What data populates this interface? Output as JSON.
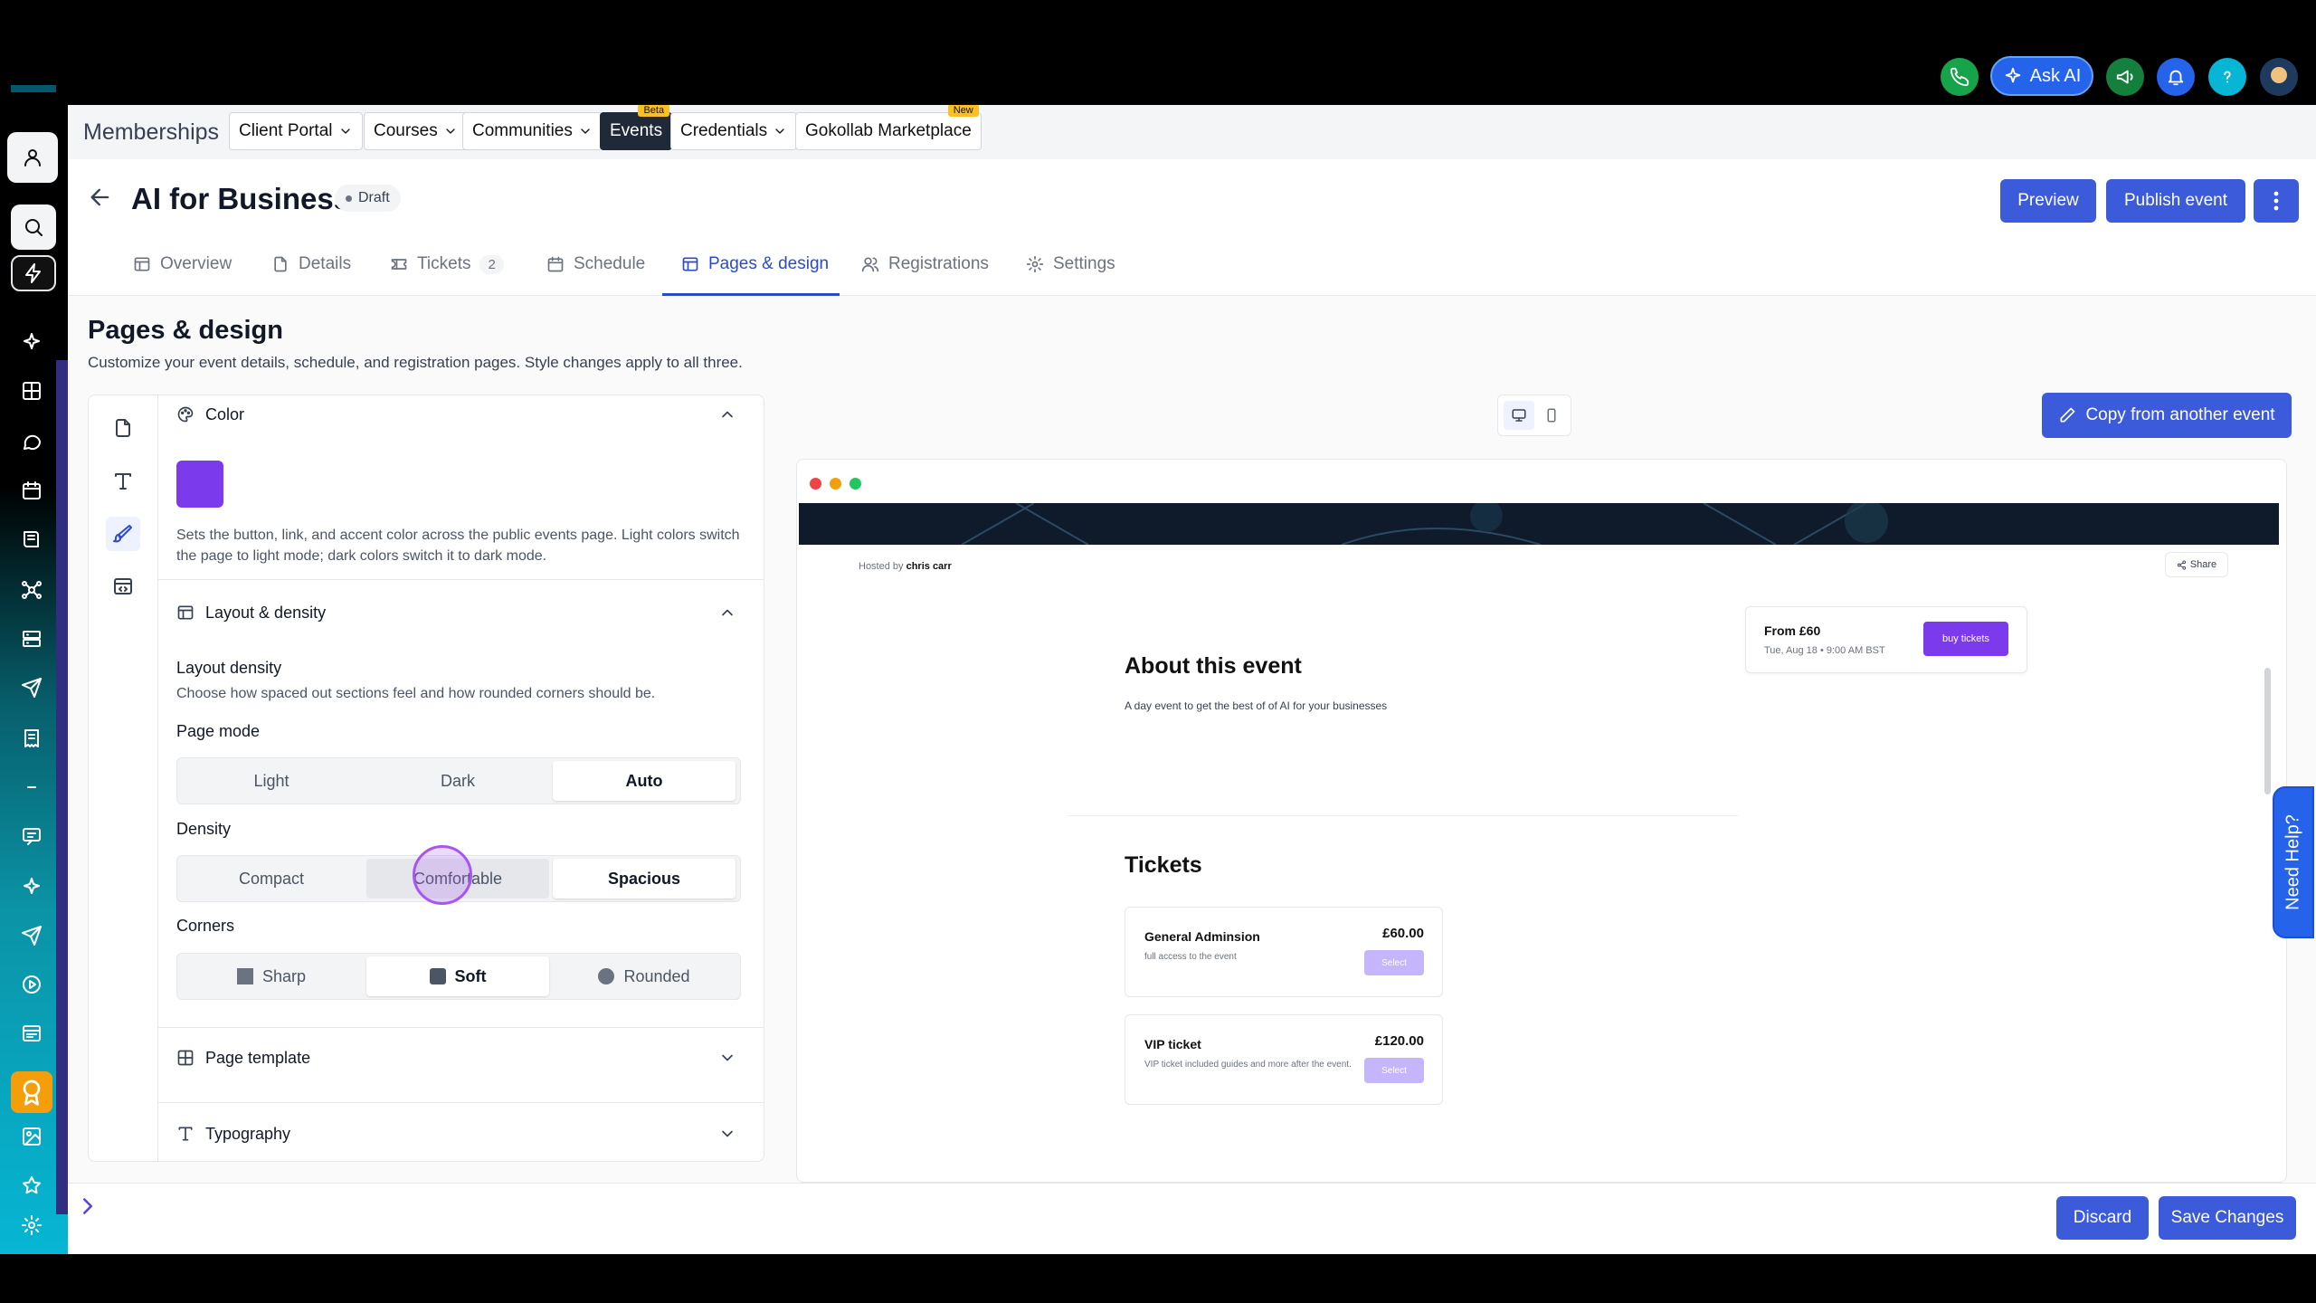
{
  "topbar": {
    "ask_ai_label": "Ask AI",
    "icons": [
      "phone-icon",
      "megaphone-icon",
      "bell-icon",
      "help-icon",
      "avatar"
    ],
    "colors": {
      "phone": "#16a34a",
      "ask_ai": "#2563eb",
      "megaphone": "#15803d",
      "bell": "#2563eb",
      "help": "#06b6d4"
    }
  },
  "subnav": {
    "label": "Memberships",
    "items": [
      {
        "label": "Client Portal",
        "dropdown": true
      },
      {
        "label": "Courses",
        "dropdown": true
      },
      {
        "label": "Communities",
        "dropdown": true
      },
      {
        "label": "Events",
        "badge": "Beta",
        "active": true
      },
      {
        "label": "Credentials",
        "dropdown": true
      },
      {
        "label": "Gokollab Marketplace",
        "badge": "New"
      }
    ]
  },
  "header": {
    "title": "AI for Business",
    "status": "Draft",
    "preview_label": "Preview",
    "publish_label": "Publish event"
  },
  "tabs": [
    {
      "label": "Overview",
      "icon": "layout-icon"
    },
    {
      "label": "Details",
      "icon": "file-icon"
    },
    {
      "label": "Tickets",
      "icon": "ticket-icon",
      "count": "2"
    },
    {
      "label": "Schedule",
      "icon": "calendar-icon"
    },
    {
      "label": "Pages & design",
      "icon": "layout-icon",
      "active": true
    },
    {
      "label": "Registrations",
      "icon": "users-icon"
    },
    {
      "label": "Settings",
      "icon": "gear-icon"
    }
  ],
  "page": {
    "title": "Pages & design",
    "subtitle": "Customize your event details, schedule, and registration pages. Style changes apply to all three."
  },
  "panel": {
    "color": {
      "heading": "Color",
      "value": "#7c3aed",
      "description_1": "Sets the button, link, and accent color across the public events page. Light colors switch",
      "description_2": "the page to light mode; dark colors switch it to dark mode."
    },
    "layout": {
      "heading": "Layout & density",
      "density_title": "Layout density",
      "density_desc": "Choose how spaced out sections feel and how rounded corners should be.",
      "page_mode_label": "Page mode",
      "page_mode_options": [
        "Light",
        "Dark",
        "Auto"
      ],
      "page_mode_selected": "Auto",
      "density_label": "Density",
      "density_options": [
        "Compact",
        "Comfortable",
        "Spacious"
      ],
      "density_selected": "Spacious",
      "corners_label": "Corners",
      "corners_options": [
        "Sharp",
        "Soft",
        "Rounded"
      ],
      "corners_selected": "Soft"
    },
    "template_heading": "Page template",
    "typography_heading": "Typography"
  },
  "copy_button": "Copy from another event",
  "preview": {
    "hosted_prefix": "Hosted by",
    "host": "chris carr",
    "share": "Share",
    "from_price": "From £60",
    "date": "Tue, Aug 18 • 9:00 AM BST",
    "buy_label": "buy tickets",
    "about_title": "About this event",
    "about_desc": "A day event to get the best of of AI for your businesses",
    "tickets_title": "Tickets",
    "tickets": [
      {
        "name": "General Adminsion",
        "desc": "full access to the event",
        "price": "£60.00",
        "button": "Select"
      },
      {
        "name": "VIP ticket",
        "desc": "VIP ticket included guides and more after the event.",
        "price": "£120.00",
        "button": "Select"
      }
    ]
  },
  "need_help": "Need Help?",
  "footer": {
    "discard": "Discard",
    "save": "Save Changes"
  }
}
